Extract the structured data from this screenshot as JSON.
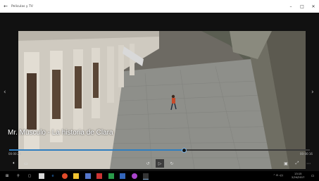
{
  "window": {
    "title": "Películas y TV",
    "back_icon": "back-arrow-icon",
    "minimize": "–",
    "maximize": "□",
    "close": "✕"
  },
  "video": {
    "caption": "Mr. Músculo - La historia de Clara",
    "progress": 0.58,
    "time_elapsed": "00:00:24",
    "time_remaining": "00:00:16"
  },
  "controls": {
    "volume_icon": "volume-icon",
    "subtitles_icon": "subtitles-icon",
    "rewind_icon": "rewind-icon",
    "play_icon": "play-icon",
    "forward_icon": "forward-icon",
    "miniview_icon": "miniview-icon",
    "fullscreen_icon": "fullscreen-icon",
    "more_icon": "more-icon"
  },
  "taskbar": {
    "time": "13:15",
    "date": "2/24/2017"
  }
}
